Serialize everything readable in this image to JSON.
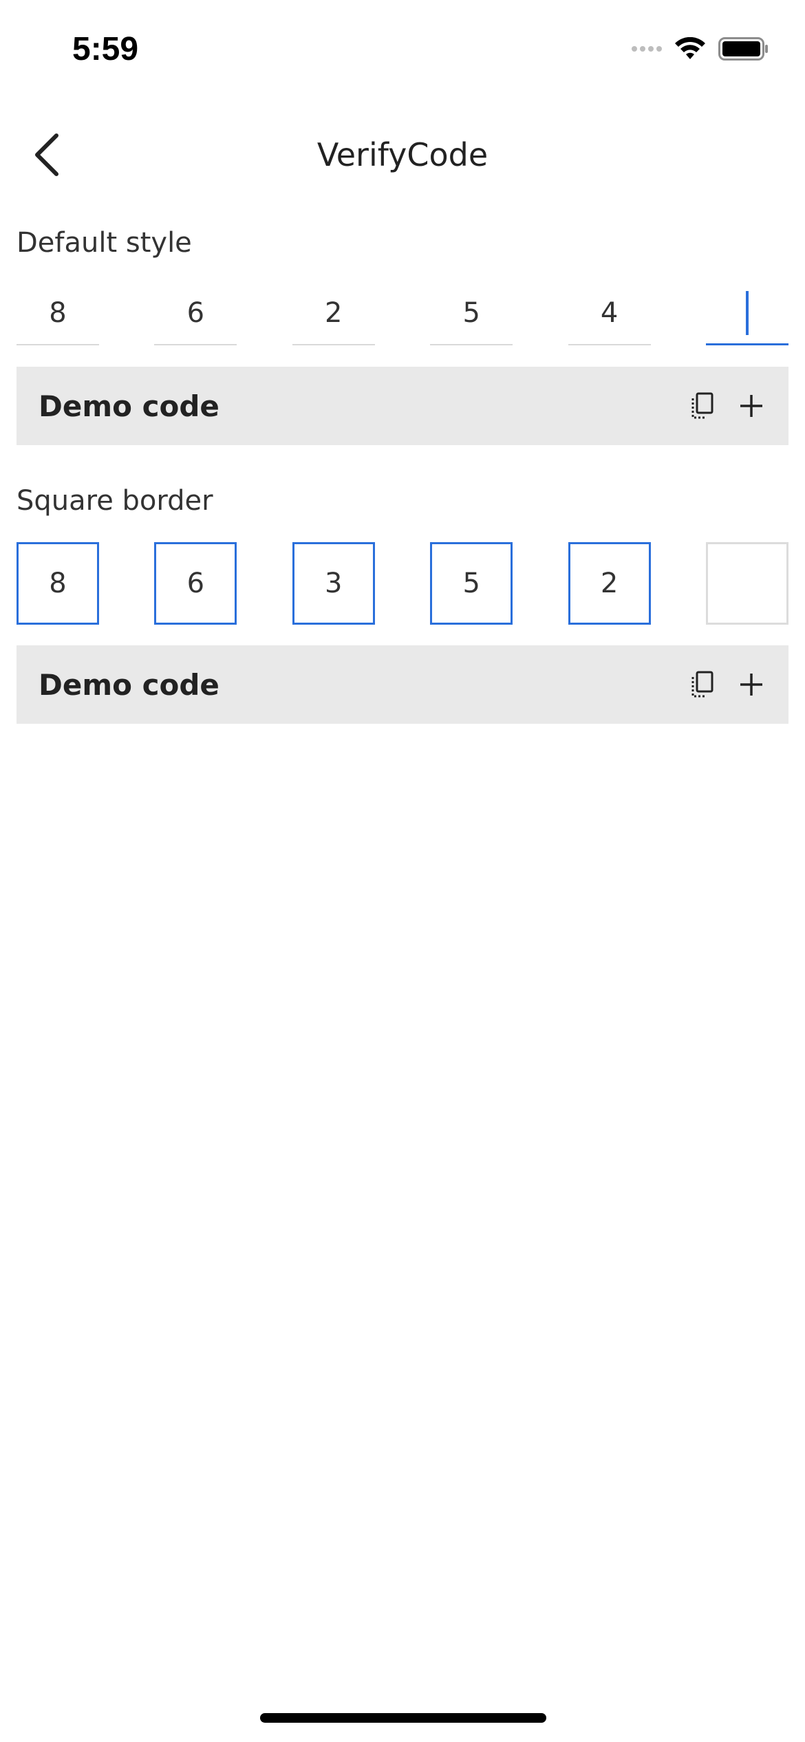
{
  "status_bar": {
    "time": "5:59",
    "icons": [
      "cellular-signal-icon",
      "wifi-icon",
      "battery-icon"
    ]
  },
  "nav": {
    "title": "VerifyCode",
    "back_icon": "chevron-left-icon"
  },
  "sections": [
    {
      "title": "Default style",
      "style": "underline",
      "digits": [
        "8",
        "6",
        "2",
        "5",
        "4",
        ""
      ],
      "active_index": 5,
      "demo_label": "Demo code"
    },
    {
      "title": "Square border",
      "style": "square",
      "digits": [
        "8",
        "6",
        "3",
        "5",
        "2",
        ""
      ],
      "active_index": 5,
      "demo_label": "Demo code"
    }
  ],
  "demo_icons": [
    "copy-icon",
    "plus-icon"
  ],
  "colors": {
    "accent": "#2a6fdb",
    "demo_background": "#e9e9e9",
    "inactive_border": "#d9d9d9"
  }
}
